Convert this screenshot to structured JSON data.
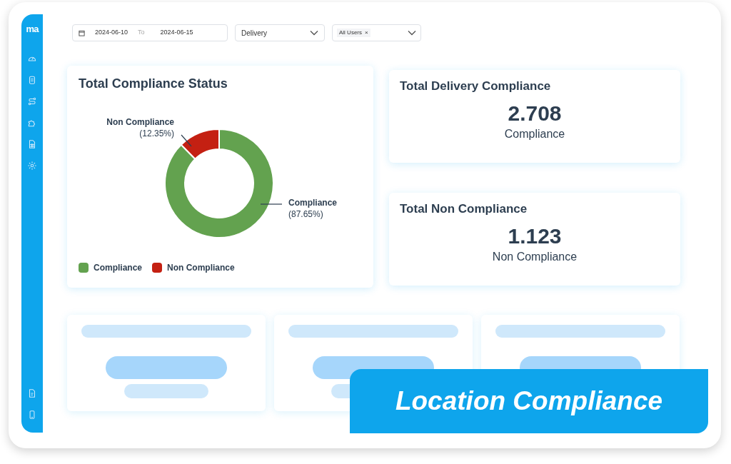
{
  "sidebar": {
    "logo": "ma"
  },
  "filters": {
    "date_from": "2024-06-10",
    "date_separator": "To",
    "date_to": "2024-06-15",
    "type": "Delivery",
    "users_tag": "All Users",
    "tag_remove": "×"
  },
  "compliance_card": {
    "title": "Total Compliance Status",
    "chart_data": {
      "type": "donut",
      "categories": [
        "Compliance",
        "Non Compliance"
      ],
      "values": [
        87.65,
        12.35
      ],
      "colors": [
        "#63a24f",
        "#c42012"
      ],
      "value_labels": [
        "(87.65%)",
        "(12.35%)"
      ]
    },
    "legend": [
      {
        "label": "Compliance",
        "color": "#63a24f"
      },
      {
        "label": "Non Compliance",
        "color": "#c42012"
      }
    ]
  },
  "stat_cards": [
    {
      "title": "Total Delivery Compliance",
      "value": "2.708",
      "caption": "Compliance"
    },
    {
      "title": "Total Non Compliance",
      "value": "1.123",
      "caption": "Non Compliance"
    }
  ],
  "banner": {
    "text": "Location Compliance"
  }
}
